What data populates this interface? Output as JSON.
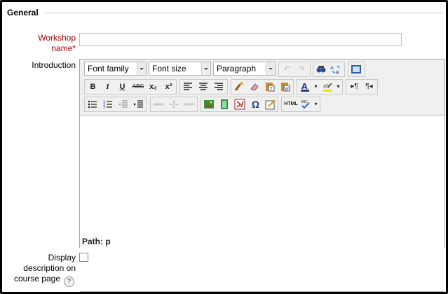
{
  "section": {
    "legend": "General"
  },
  "workshop_name": {
    "label_line1": "Workshop",
    "label_line2": "name",
    "required_mark": "*",
    "value": ""
  },
  "introduction": {
    "label": "Introduction"
  },
  "editor": {
    "font_family": "Font family",
    "font_size": "Font size",
    "format": "Paragraph",
    "path_text": "Path: p",
    "buttons": {
      "bold": "B",
      "italic": "I",
      "underline": "U",
      "strike": "ABC",
      "subscript": "x₂",
      "superscript": "x²",
      "omega": "Ω",
      "html": "HTML",
      "ltr": "▸¶",
      "rtl": "¶◂",
      "spell": "ABC"
    }
  },
  "display_description": {
    "label_line1": "Display",
    "label_line2": "description on",
    "label_line3": "course page",
    "help": "?"
  },
  "colors": {
    "required": "#a00000",
    "toolbar": "#f0f0ee"
  }
}
